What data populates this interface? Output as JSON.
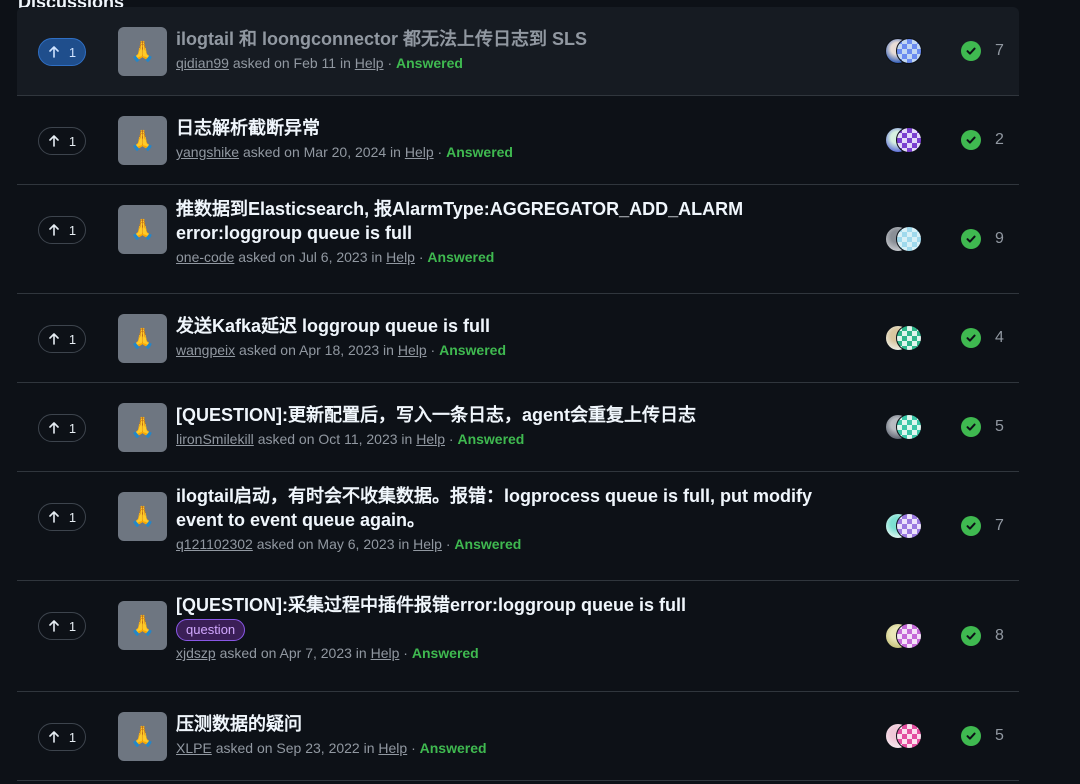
{
  "section_title": "Discussions",
  "separator": "·",
  "discussions": [
    {
      "votes": "1",
      "title": "ilogtail 和 loongconnector 都无法上传日志到 SLS",
      "author": "qidian99",
      "time": "asked on Feb 11 in",
      "category": "Help",
      "status": "Answered",
      "count": "7",
      "avatar_colors": [
        "#e8ddd6",
        "#2c5ab8",
        "#c2d8f2",
        "#6a8cf0"
      ]
    },
    {
      "votes": "1",
      "title": "日志解析截断异常",
      "author": "yangshike",
      "time": "asked on Mar 20, 2024 in",
      "category": "Help",
      "status": "Answered",
      "count": "2",
      "avatar_colors": [
        "#d6f0e0",
        "#5b6bd8",
        "#e2d8f8",
        "#7a3fd0"
      ]
    },
    {
      "votes": "1",
      "title": "推数据到Elasticsearch, 报AlarmType:AGGREGATOR_ADD_ALARM error:loggroup queue is full",
      "author": "one-code",
      "time": "asked on Jul 6, 2023 in",
      "category": "Help",
      "status": "Answered",
      "count": "9",
      "avatar_colors": [
        "#8a8f96",
        "#c9ccd1",
        "#d8f0f6",
        "#9fd9ec"
      ]
    },
    {
      "votes": "1",
      "title": "发送Kafka延迟 loggroup queue is full",
      "author": "wangpeix",
      "time": "asked on Apr 18, 2023 in",
      "category": "Help",
      "status": "Answered",
      "count": "4",
      "avatar_colors": [
        "#d9c7a0",
        "#eef0e8",
        "#2fb68a",
        "#dff5ec"
      ]
    },
    {
      "votes": "1",
      "title": "[QUESTION]:更新配置后，写入一条日志，agent会重复上传日志",
      "author": "lironSmilekill",
      "time": "asked on Oct 11, 2023 in",
      "category": "Help",
      "status": "Answered",
      "count": "5",
      "avatar_colors": [
        "#b8bcc2",
        "#5d6470",
        "#3cc7a8",
        "#dff6ef"
      ]
    },
    {
      "votes": "1",
      "title": "ilogtail启动，有时会不收集数据。报错：logprocess queue is full, put modify event to event queue again。",
      "author": "q121102302",
      "time": "asked on May 6, 2023 in",
      "category": "Help",
      "status": "Answered",
      "count": "7",
      "avatar_colors": [
        "#7ee0d2",
        "#e6f8f4",
        "#9b7ae0",
        "#ece4fb"
      ]
    },
    {
      "votes": "1",
      "title": "[QUESTION]:采集过程中插件报错error:loggroup queue is full",
      "author": "xjdszp",
      "time": "asked on Apr 7, 2023 in",
      "category": "Help",
      "status": "Answered",
      "count": "8",
      "label": "question",
      "avatar_colors": [
        "#eae7b8",
        "#c4c07a",
        "#c46ad8",
        "#f4e3f8"
      ]
    },
    {
      "votes": "1",
      "title": "压测数据的疑问",
      "author": "XLPE",
      "time": "asked on Sep 23, 2022 in",
      "category": "Help",
      "status": "Answered",
      "count": "5",
      "avatar_colors": [
        "#f0c8d8",
        "#f6e9ef",
        "#e34fa0",
        "#fbe1ee"
      ]
    }
  ],
  "icons": {
    "upvote": "arrow-up-icon",
    "category": "folded-hands-emoji",
    "answered": "check-circle-icon"
  },
  "category_emoji": "🙏",
  "colors": {
    "answered": "#3fb950",
    "upvote_active": "#1f4e8c",
    "label": "#d2a8ff"
  }
}
